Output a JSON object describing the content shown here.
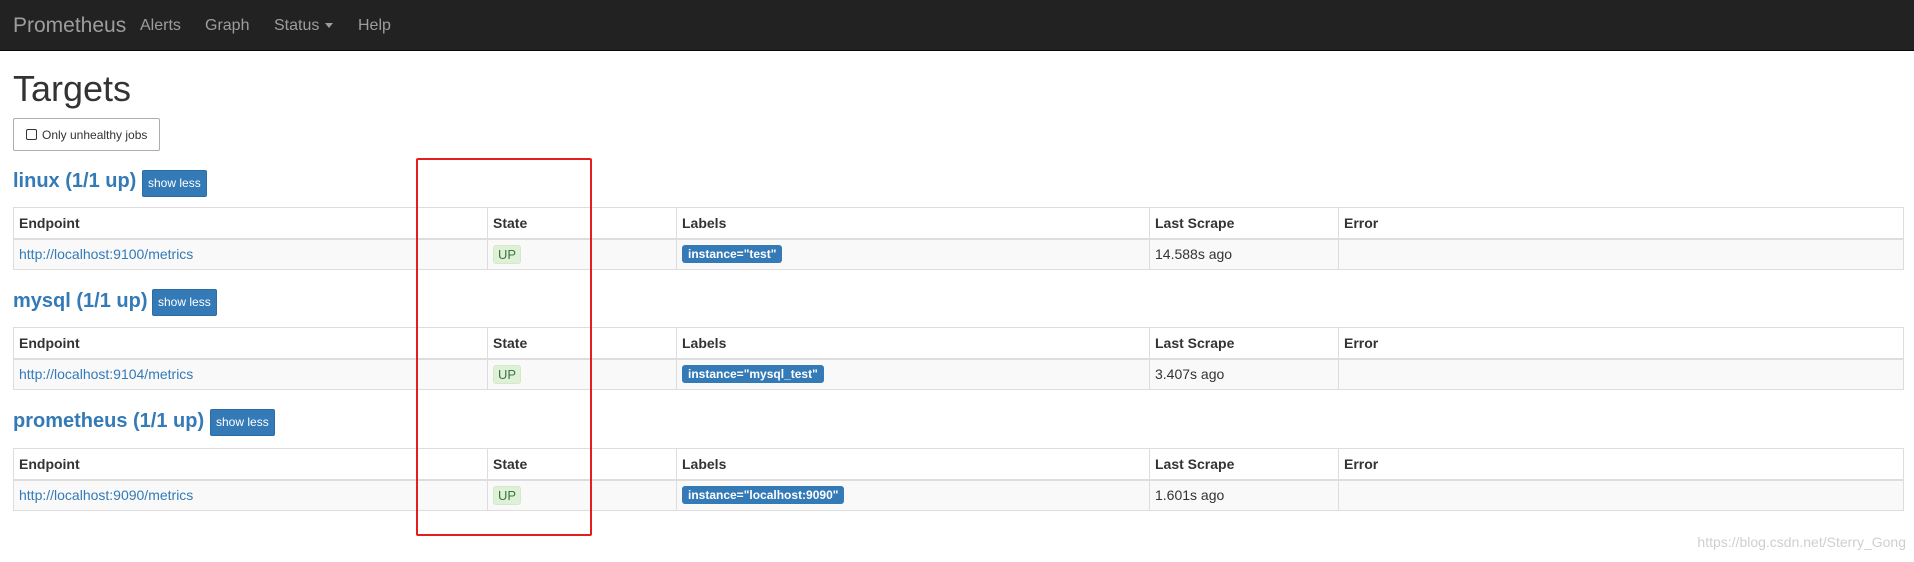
{
  "navbar": {
    "brand": "Prometheus",
    "items": [
      {
        "label": "Alerts"
      },
      {
        "label": "Graph"
      },
      {
        "label": "Status"
      },
      {
        "label": "Help"
      }
    ]
  },
  "page": {
    "title": "Targets",
    "filter_label": "Only unhealthy jobs"
  },
  "table_headers": {
    "endpoint": "Endpoint",
    "state": "State",
    "labels": "Labels",
    "last_scrape": "Last Scrape",
    "error": "Error"
  },
  "jobs": [
    {
      "title": "linux (1/1 up)",
      "toggle": "show less",
      "endpoint": "http://localhost:9100/metrics",
      "state": "UP",
      "label": "instance=\"test\"",
      "last_scrape": "14.588s ago",
      "error": ""
    },
    {
      "title": "mysql (1/1 up)",
      "toggle": "show less",
      "endpoint": "http://localhost:9104/metrics",
      "state": "UP",
      "label": "instance=\"mysql_test\"",
      "last_scrape": "3.407s ago",
      "error": ""
    },
    {
      "title": "prometheus (1/1 up)",
      "toggle": "show less",
      "endpoint": "http://localhost:9090/metrics",
      "state": "UP",
      "label": "instance=\"localhost:9090\"",
      "last_scrape": "1.601s ago",
      "error": ""
    }
  ],
  "watermark": "https://blog.csdn.net/Sterry_Gong",
  "colors": {
    "navbar_bg": "#222222",
    "link_blue": "#337ab7",
    "state_up_bg": "#dff0d8",
    "state_up_text": "#3c763d",
    "highlight_red": "#e51d1d"
  }
}
